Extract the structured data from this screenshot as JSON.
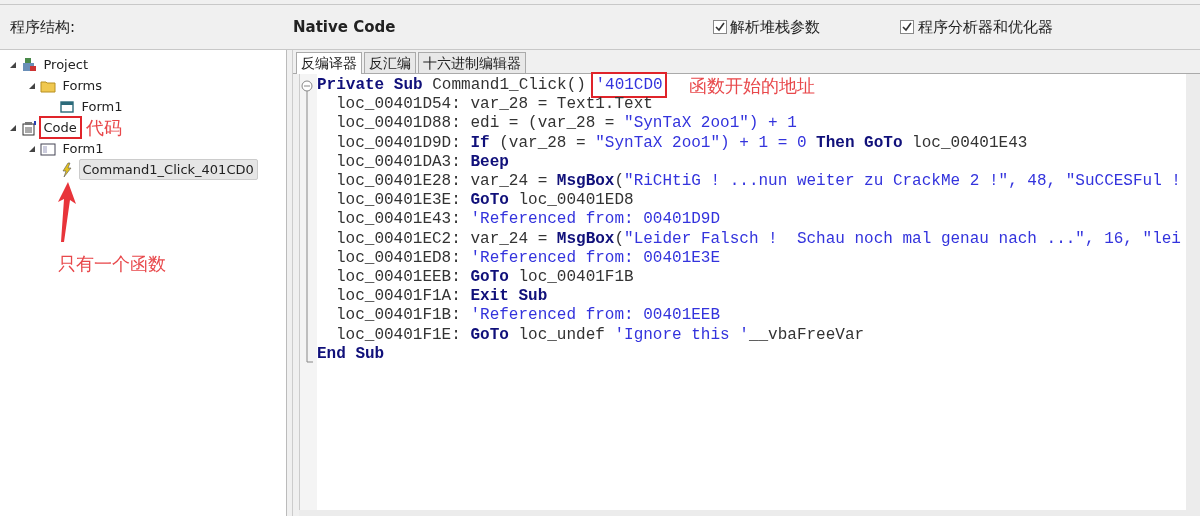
{
  "toolbar": {
    "structure_label": "程序结构:",
    "mode_label": "Native Code",
    "options": [
      {
        "label": "解析堆栈参数",
        "checked": true
      },
      {
        "label": "程序分析器和优化器",
        "checked": true
      }
    ]
  },
  "tree": [
    {
      "label": "Project",
      "kind": "project",
      "expanded": true,
      "selected": false,
      "highlighted": false,
      "children": [
        {
          "label": "Forms",
          "kind": "folder",
          "expanded": true,
          "selected": false,
          "highlighted": false,
          "children": [
            {
              "label": "Form1",
              "kind": "form",
              "selected": false,
              "highlighted": false
            }
          ]
        }
      ]
    },
    {
      "label": "Code",
      "kind": "code",
      "expanded": true,
      "selected": false,
      "highlighted": true,
      "note": "代码",
      "children": [
        {
          "label": "Form1",
          "kind": "module",
          "expanded": true,
          "selected": false,
          "highlighted": false,
          "children": [
            {
              "label": "Command1_Click_401CD0",
              "kind": "event",
              "selected": true,
              "highlighted": false
            }
          ]
        }
      ]
    }
  ],
  "tree_note": "只有一个函数",
  "tabs": [
    {
      "label": "反编译器",
      "selected": true
    },
    {
      "label": "反汇编",
      "selected": false
    },
    {
      "label": "十六进制编辑器",
      "selected": false
    }
  ],
  "code": [
    {
      "kind": "sub_start",
      "note": "函数开始的地址",
      "tokens": [
        {
          "kind": "kw",
          "text": "Private Sub"
        },
        {
          "kind": "txt",
          "text": " Command1_Click() "
        },
        {
          "kind": "cm",
          "text": "'401CD0",
          "highlighted": true
        }
      ]
    },
    {
      "kind": "stmt",
      "tokens": [
        {
          "kind": "txt",
          "text": "loc_00401D54: var_28 = Text1.Text"
        }
      ]
    },
    {
      "kind": "stmt",
      "tokens": [
        {
          "kind": "txt",
          "text": "loc_00401D88: edi = (var_28 = "
        },
        {
          "kind": "str",
          "text": "\"SynTaX 2oo1\") + 1"
        }
      ]
    },
    {
      "kind": "stmt",
      "tokens": [
        {
          "kind": "txt",
          "text": "loc_00401D9D: "
        },
        {
          "kind": "kw",
          "text": "If"
        },
        {
          "kind": "txt",
          "text": " (var_28 = "
        },
        {
          "kind": "str",
          "text": "\"SynTaX 2oo1\") + 1 = 0 "
        },
        {
          "kind": "kw",
          "text": "Then GoTo"
        },
        {
          "kind": "txt",
          "text": " loc_00401E43"
        }
      ]
    },
    {
      "kind": "stmt",
      "tokens": [
        {
          "kind": "txt",
          "text": "loc_00401DA3: "
        },
        {
          "kind": "kw",
          "text": "Beep"
        }
      ]
    },
    {
      "kind": "stmt",
      "tokens": [
        {
          "kind": "txt",
          "text": "loc_00401E28: var_24 = "
        },
        {
          "kind": "kw",
          "text": "MsgBox"
        },
        {
          "kind": "txt",
          "text": "("
        },
        {
          "kind": "str",
          "text": "\"RiCHtiG ! ...nun weiter zu CrackMe 2 !\", 48, \"SuCCESFul !"
        }
      ]
    },
    {
      "kind": "stmt",
      "tokens": [
        {
          "kind": "txt",
          "text": "loc_00401E3E: "
        },
        {
          "kind": "kw",
          "text": "GoTo"
        },
        {
          "kind": "txt",
          "text": " loc_00401ED8"
        }
      ]
    },
    {
      "kind": "stmt",
      "tokens": [
        {
          "kind": "txt",
          "text": "loc_00401E43: "
        },
        {
          "kind": "cm",
          "text": "'Referenced from: 00401D9D"
        }
      ]
    },
    {
      "kind": "stmt",
      "tokens": [
        {
          "kind": "txt",
          "text": "loc_00401EC2: var_24 = "
        },
        {
          "kind": "kw",
          "text": "MsgBox"
        },
        {
          "kind": "txt",
          "text": "("
        },
        {
          "kind": "str",
          "text": "\"Leider Falsch !  Schau noch mal genau nach ...\", 16, \"lei"
        }
      ]
    },
    {
      "kind": "stmt",
      "tokens": [
        {
          "kind": "txt",
          "text": "loc_00401ED8: "
        },
        {
          "kind": "cm",
          "text": "'Referenced from: 00401E3E"
        }
      ]
    },
    {
      "kind": "stmt",
      "tokens": [
        {
          "kind": "txt",
          "text": "loc_00401EEB: "
        },
        {
          "kind": "kw",
          "text": "GoTo"
        },
        {
          "kind": "txt",
          "text": " loc_00401F1B"
        }
      ]
    },
    {
      "kind": "stmt",
      "tokens": [
        {
          "kind": "txt",
          "text": "loc_00401F1A: "
        },
        {
          "kind": "kw",
          "text": "Exit Sub"
        }
      ]
    },
    {
      "kind": "stmt",
      "tokens": [
        {
          "kind": "txt",
          "text": "loc_00401F1B: "
        },
        {
          "kind": "cm",
          "text": "'Referenced from: 00401EEB"
        }
      ]
    },
    {
      "kind": "stmt",
      "tokens": [
        {
          "kind": "txt",
          "text": "loc_00401F1E: "
        },
        {
          "kind": "kw",
          "text": "GoTo"
        },
        {
          "kind": "txt",
          "text": " loc_undef "
        },
        {
          "kind": "cm",
          "text": "'Ignore this '"
        },
        {
          "kind": "txt",
          "text": "__vbaFreeVar"
        }
      ]
    },
    {
      "kind": "sub_end",
      "tokens": [
        {
          "kind": "kw",
          "text": "End Sub"
        }
      ]
    }
  ]
}
